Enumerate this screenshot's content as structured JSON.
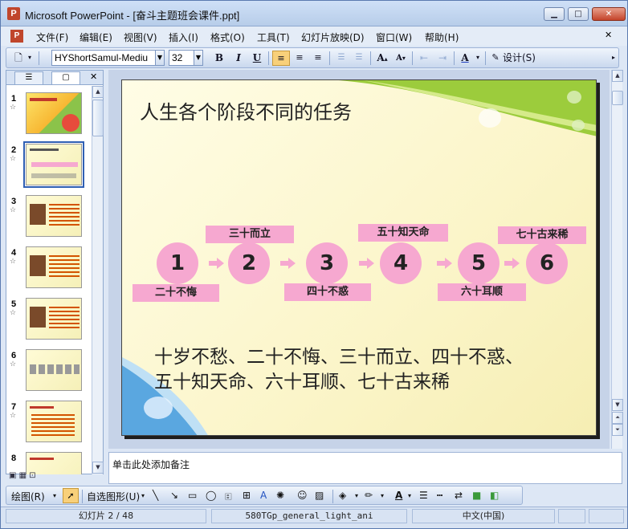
{
  "window": {
    "title": "Microsoft PowerPoint - [奋斗主题班会课件.ppt]"
  },
  "menu": [
    "文件(F)",
    "编辑(E)",
    "视图(V)",
    "插入(I)",
    "格式(O)",
    "工具(T)",
    "幻灯片放映(D)",
    "窗口(W)",
    "帮助(H)"
  ],
  "toolbar": {
    "font_name": "HYShortSamul-Mediu",
    "font_size": "32",
    "bold": "B",
    "italic": "I",
    "underline": "U",
    "design_label": "设计(S)",
    "font_color_glyph": "A"
  },
  "slides_pane": {
    "numbers": [
      "1",
      "2",
      "3",
      "4",
      "5",
      "6",
      "7",
      "8"
    ],
    "selected": 2
  },
  "slide": {
    "title": "人生各个阶段不同的任务",
    "circles": [
      "1",
      "2",
      "3",
      "4",
      "5",
      "6"
    ],
    "labels": {
      "top1": "三十而立",
      "top2": "五十知天命",
      "top3": "七十古来稀",
      "bottom1": "二十不悔",
      "bottom2": "四十不惑",
      "bottom3": "六十耳顺"
    },
    "body_line1": "十岁不愁、二十不悔、三十而立、四十不惑、",
    "body_line2": "五十知天命、六十耳顺、七十古来稀"
  },
  "notes": {
    "placeholder": "单击此处添加备注"
  },
  "drawing_toolbar": {
    "draw_label": "绘图(R)",
    "autoshapes_label": "自选图形(U)"
  },
  "status": {
    "slide_info": "幻灯片 2 / 48",
    "design": "580TGp_general_light_ani",
    "language": "中文(中国)"
  },
  "colors": {
    "accent_pink": "#f6a8d0",
    "window_blue": "#dde7f5"
  }
}
